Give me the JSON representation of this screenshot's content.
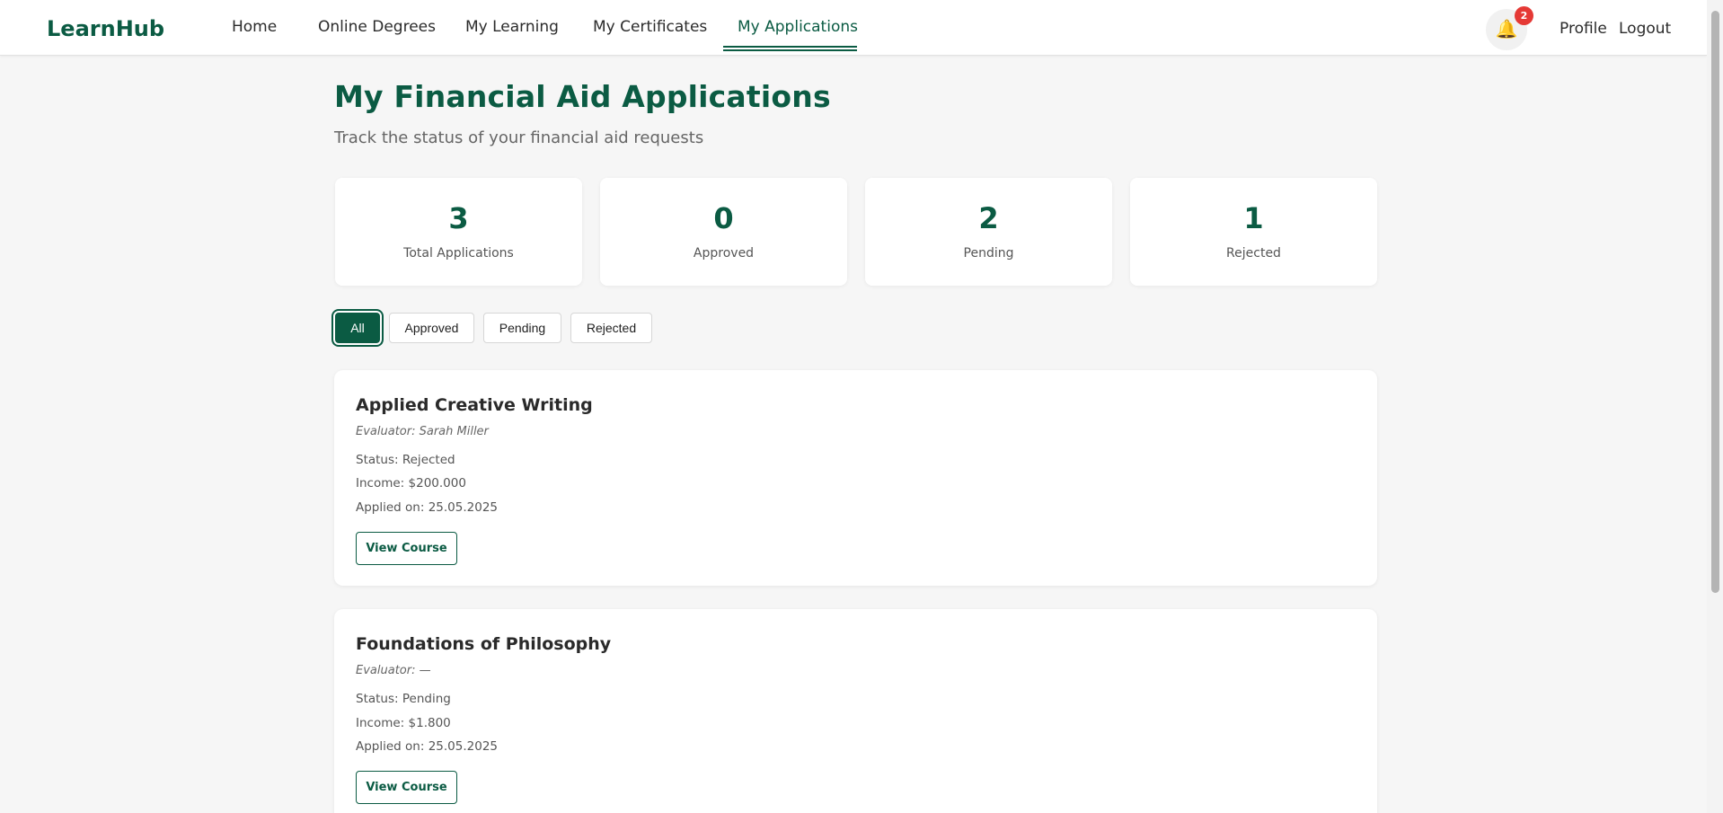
{
  "header": {
    "logo": "LearnHub",
    "nav": [
      {
        "label": "Home"
      },
      {
        "label": "Online Degrees"
      },
      {
        "label": "My Learning"
      },
      {
        "label": "My Certificates"
      },
      {
        "label": "My Applications",
        "active": true
      }
    ],
    "notifications": {
      "icon": "bell-icon",
      "count": "2"
    },
    "profile_label": "Profile",
    "logout_label": "Logout"
  },
  "page": {
    "title": "My Financial Aid Applications",
    "subtitle": "Track the status of your financial aid requests"
  },
  "stats": [
    {
      "value": "3",
      "label": "Total Applications"
    },
    {
      "value": "0",
      "label": "Approved"
    },
    {
      "value": "2",
      "label": "Pending"
    },
    {
      "value": "1",
      "label": "Rejected"
    }
  ],
  "filters": [
    {
      "label": "All",
      "active": true
    },
    {
      "label": "Approved"
    },
    {
      "label": "Pending"
    },
    {
      "label": "Rejected"
    }
  ],
  "applications": [
    {
      "title": "Applied Creative Writing",
      "evaluator": "Evaluator: Sarah Miller",
      "status": "Status: Rejected",
      "income": "Income: $200.000",
      "applied": "Applied on: 25.05.2025",
      "button": "View Course"
    },
    {
      "title": "Foundations of Philosophy",
      "evaluator": "Evaluator: —",
      "status": "Status: Pending",
      "income": "Income: $1.800",
      "applied": "Applied on: 25.05.2025",
      "button": "View Course"
    }
  ],
  "colors": {
    "brand": "#0b5b43",
    "badge": "#e53935",
    "bell": "#f0a500"
  }
}
